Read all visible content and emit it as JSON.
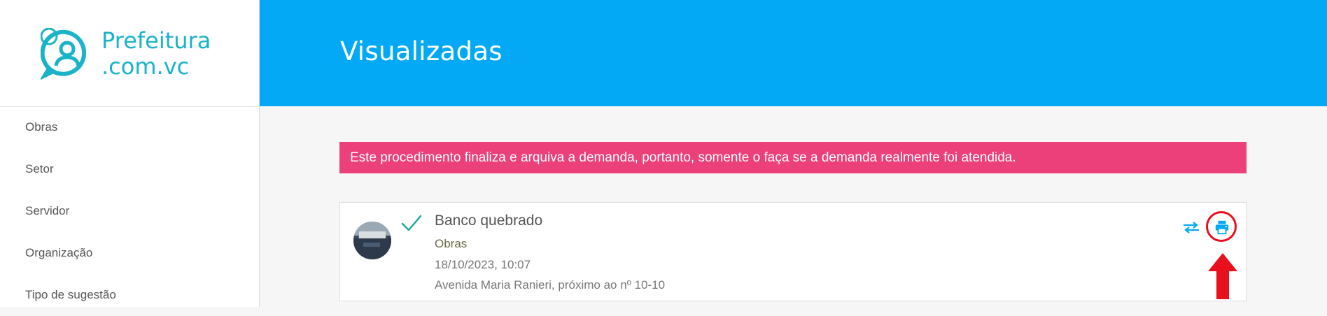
{
  "brand": {
    "line1": "Prefeitura",
    "line2": ".com.vc",
    "color": "#1ab3c8"
  },
  "header": {
    "title": "Visualizadas",
    "background": "#03a9f4"
  },
  "sidebar": {
    "items": [
      {
        "label": "Obras"
      },
      {
        "label": "Setor"
      },
      {
        "label": "Servidor"
      },
      {
        "label": "Organização"
      },
      {
        "label": "Tipo de sugestão"
      }
    ]
  },
  "alert": {
    "text": "Este procedimento finaliza e arquiva a demanda, portanto, somente o faça se a demanda realmente foi atendida.",
    "color": "#ec407a"
  },
  "demand": {
    "title": "Banco quebrado",
    "category": "Obras",
    "date": "18/10/2023, 10:07",
    "address": "Avenida Maria Ranieri, próximo ao nº 10-10",
    "status_icon": "check-icon",
    "actions": [
      "transfer-icon",
      "print-icon"
    ]
  },
  "annotation": {
    "highlight_color": "#e8101d",
    "icon": "arrow-up-icon"
  }
}
